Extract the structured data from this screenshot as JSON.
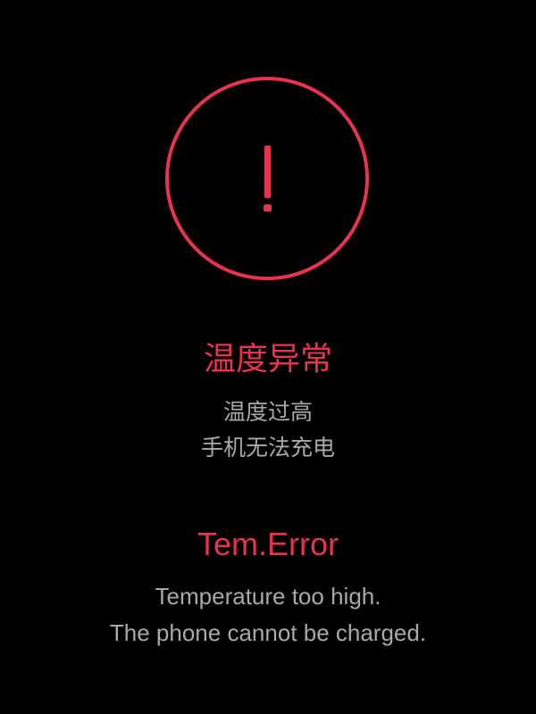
{
  "alert": {
    "icon": "exclamation-circle-icon",
    "color": "#E8334F"
  },
  "chinese": {
    "title": "温度异常",
    "line1": "温度过高",
    "line2": "手机无法充电"
  },
  "english": {
    "title": "Tem.Error",
    "line1": "Temperature too high.",
    "line2": "The phone cannot be charged."
  },
  "colors": {
    "background": "#000000",
    "accent": "#E8334F",
    "secondary_text": "#A9A9A9"
  }
}
